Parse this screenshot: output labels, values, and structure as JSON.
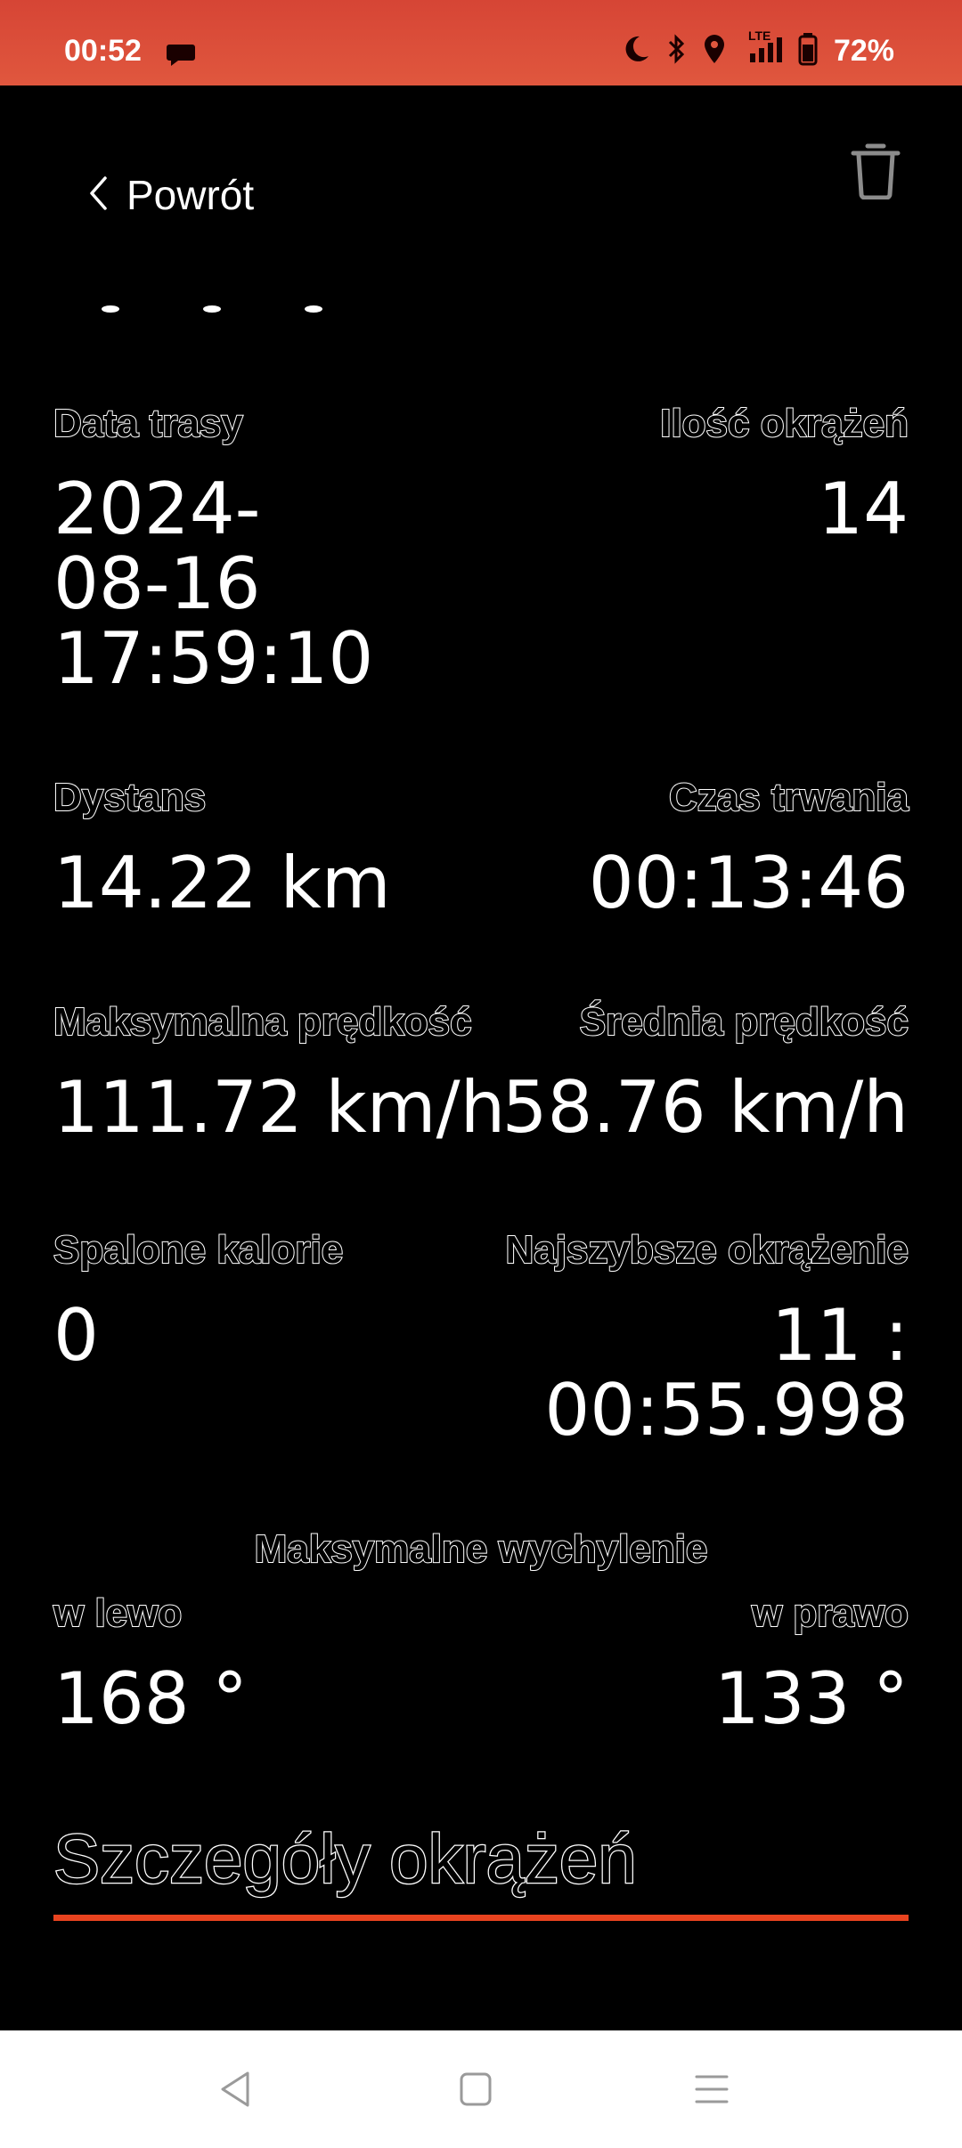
{
  "status_bar": {
    "time": "00:52",
    "battery": "72%",
    "network": "LTE",
    "icons": [
      "message-icon",
      "moon-icon",
      "bluetooth-icon",
      "location-icon",
      "signal-icon",
      "battery-icon"
    ]
  },
  "header": {
    "back_label": "Powrót",
    "icons": [
      "chevron-left-icon",
      "trash-icon"
    ]
  },
  "stats": {
    "route_date": {
      "label": "Data trasy",
      "value": "2024-\n08-16\n17:59:10"
    },
    "lap_count": {
      "label": "Ilość okrążeń",
      "value": "14"
    },
    "distance": {
      "label": "Dystans",
      "value": "14.22 km"
    },
    "duration": {
      "label": "Czas trwania",
      "value": "00:13:46"
    },
    "max_speed": {
      "label": "Maksymalna prędkość",
      "value": "111.72 km/h"
    },
    "avg_speed": {
      "label": "Średnia prędkość",
      "value": "58.76 km/h"
    },
    "calories": {
      "label": "Spalone kalorie",
      "value": "0"
    },
    "fastest_lap": {
      "label": "Najszybsze okrążenie",
      "value": "11 :\n00:55.998"
    }
  },
  "lean": {
    "title": "Maksymalne wychylenie",
    "left_label": "w lewo",
    "left_value": "168 °",
    "right_label": "w prawo",
    "right_value": "133 °"
  },
  "section": {
    "title": "Szczegóły okrążeń",
    "accent": "#e8431f"
  },
  "nav_bar": {
    "icons": [
      "back-triangle-icon",
      "home-square-icon",
      "recents-menu-icon"
    ]
  }
}
